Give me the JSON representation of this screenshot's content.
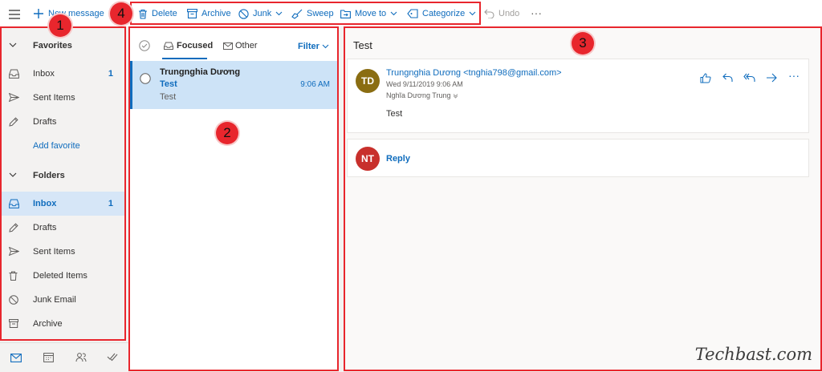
{
  "toolbar": {
    "new_message": "New message",
    "delete": "Delete",
    "archive": "Archive",
    "junk": "Junk",
    "sweep": "Sweep",
    "move_to": "Move to",
    "categorize": "Categorize",
    "undo": "Undo",
    "more_icon": "ellipsis-icon"
  },
  "callouts": [
    "1",
    "2",
    "3",
    "4"
  ],
  "nav": {
    "favorites_header": "Favorites",
    "favorites": [
      {
        "label": "Inbox",
        "count": "1",
        "icon": "inbox-icon"
      },
      {
        "label": "Sent Items",
        "count": "",
        "icon": "sent-icon"
      },
      {
        "label": "Drafts",
        "count": "",
        "icon": "pencil-icon"
      }
    ],
    "add_favorite": "Add favorite",
    "folders_header": "Folders",
    "folders": [
      {
        "label": "Inbox",
        "count": "1",
        "icon": "inbox-icon",
        "selected": true
      },
      {
        "label": "Drafts",
        "count": "",
        "icon": "pencil-icon"
      },
      {
        "label": "Sent Items",
        "count": "",
        "icon": "sent-icon"
      },
      {
        "label": "Deleted Items",
        "count": "",
        "icon": "trash-icon"
      },
      {
        "label": "Junk Email",
        "count": "",
        "icon": "blocked-icon"
      },
      {
        "label": "Archive",
        "count": "",
        "icon": "archive-icon"
      }
    ],
    "bottom_icons": [
      "mail-icon",
      "calendar-icon",
      "people-icon",
      "tasks-icon"
    ]
  },
  "list": {
    "tab_focused": "Focused",
    "tab_other": "Other",
    "filter": "Filter",
    "message": {
      "sender": "Trungnghia Dương",
      "subject": "Test",
      "time": "9:06 AM",
      "preview": "Test"
    }
  },
  "reading": {
    "subject": "Test",
    "sender_initials": "TD",
    "sender": "Trungnghia Dương <tnghia798@gmail.com>",
    "date": "Wed 9/11/2019 9:06 AM",
    "to": "Nghĩa Dương Trung",
    "body": "Test",
    "reply_initials": "NT",
    "reply": "Reply",
    "colors": {
      "sender_avatar": "#8a6d12",
      "reply_avatar": "#c8302c",
      "accent": "#0f6cbd"
    }
  },
  "watermark": "Techbast.com"
}
